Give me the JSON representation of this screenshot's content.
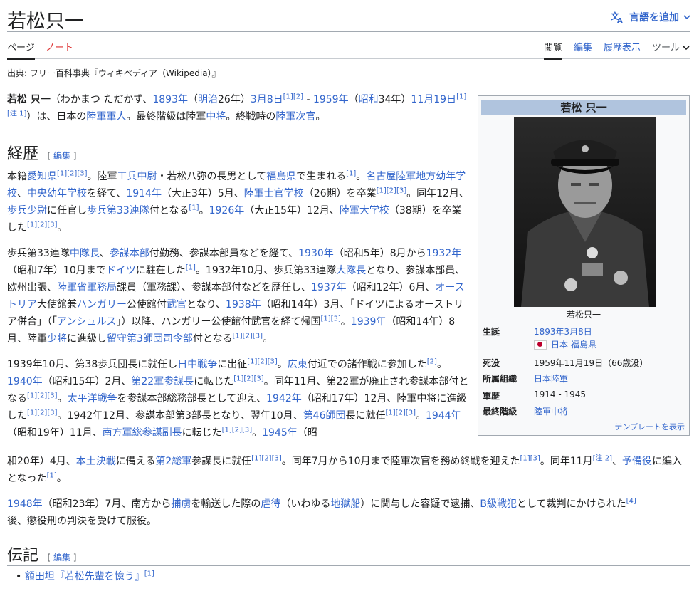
{
  "header": {
    "title": "若松只一",
    "lang_button": "言語を追加"
  },
  "tabs": {
    "page": "ページ",
    "talk": "ノート",
    "read": "閲覧",
    "edit": "編集",
    "history": "履歴表示",
    "tools": "ツール"
  },
  "source": "出典: フリー百科事典『ウィキペディア（Wikipedia）』",
  "infobox": {
    "title": "若松 只一",
    "caption": "若松只一",
    "rows": [
      {
        "label": "生誕",
        "value": "1893年3月8日"
      },
      {
        "label": "",
        "value": "日本 福島県"
      },
      {
        "label": "死没",
        "value": "1959年11月19日（66歳没）"
      },
      {
        "label": "所属組織",
        "value": "日本陸軍"
      },
      {
        "label": "軍歴",
        "value": "1914 - 1945"
      },
      {
        "label": "最終階級",
        "value": "陸軍中将"
      }
    ],
    "footer": "テンプレートを表示"
  },
  "sections": {
    "career": "経歴",
    "biography": "伝記",
    "edit_label": "編集"
  },
  "biography_item": "額田坦『若松先輩を憶う』",
  "theme": {
    "link": "#3366cc",
    "infobox_header": "#b0c4de"
  }
}
